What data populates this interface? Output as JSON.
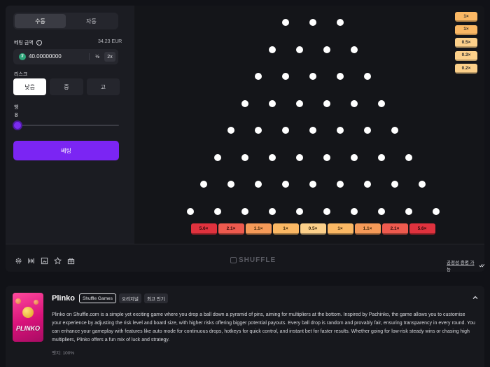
{
  "controls": {
    "mode_tabs": [
      "수동",
      "자동"
    ],
    "bet_label": "베팅 금액",
    "balance": "34.23 EUR",
    "bet_value": "40.00000000",
    "half_label": "½",
    "double_label": "2x",
    "risk_label": "리스크",
    "risk_options": [
      "낮음",
      "중",
      "고"
    ],
    "rows_label": "행",
    "rows_value": "8",
    "bet_button": "베팅"
  },
  "board": {
    "multipliers": [
      "5.6×",
      "2.1×",
      "1.1×",
      "1×",
      "0.5×",
      "1×",
      "1.1×",
      "2.1×",
      "5.6×"
    ],
    "slot_colors": [
      "#e0323e",
      "#ee5a4e",
      "#f59a58",
      "#fbb864",
      "#fcd08a",
      "#fbb864",
      "#f59a58",
      "#ee5a4e",
      "#e0323e"
    ],
    "history": [
      "1×",
      "1×",
      "0.5×",
      "0.3×",
      "0.2×"
    ],
    "history_colors": [
      "#fbb864",
      "#fbb864",
      "#fcd08a",
      "#fcd08a",
      "#fcd08a"
    ]
  },
  "bottom_bar": {
    "brand": "SHUFFLE",
    "fairness_link": "공정성 증명 가능",
    "icons": [
      "settings-icon",
      "stats-icon",
      "image-icon",
      "star-icon",
      "gift-icon"
    ]
  },
  "info": {
    "title": "Plinko",
    "tags": [
      "Shuffle Games",
      "오리지널",
      "최고 인기"
    ],
    "thumbnail_text": "PLINKO",
    "description": "Plinko on Shuffle.com is a simple yet exciting game where you drop a ball down a pyramid of pins, aiming for multipliers at the bottom. Inspired by Pachinko, the game allows you to customise your experience by adjusting the risk level and board size, with higher risks offering bigger potential payouts. Every ball drop is random and provably fair, ensuring transparency in every round. You can enhance your gameplay with features like auto mode for continuous drops, hotkeys for quick control, and instant bet for faster results. Whether going for low-risk steady wins or chasing high multipliers, Plinko offers a fun mix of luck and strategy.",
    "rtp": "엣지: 100%"
  }
}
